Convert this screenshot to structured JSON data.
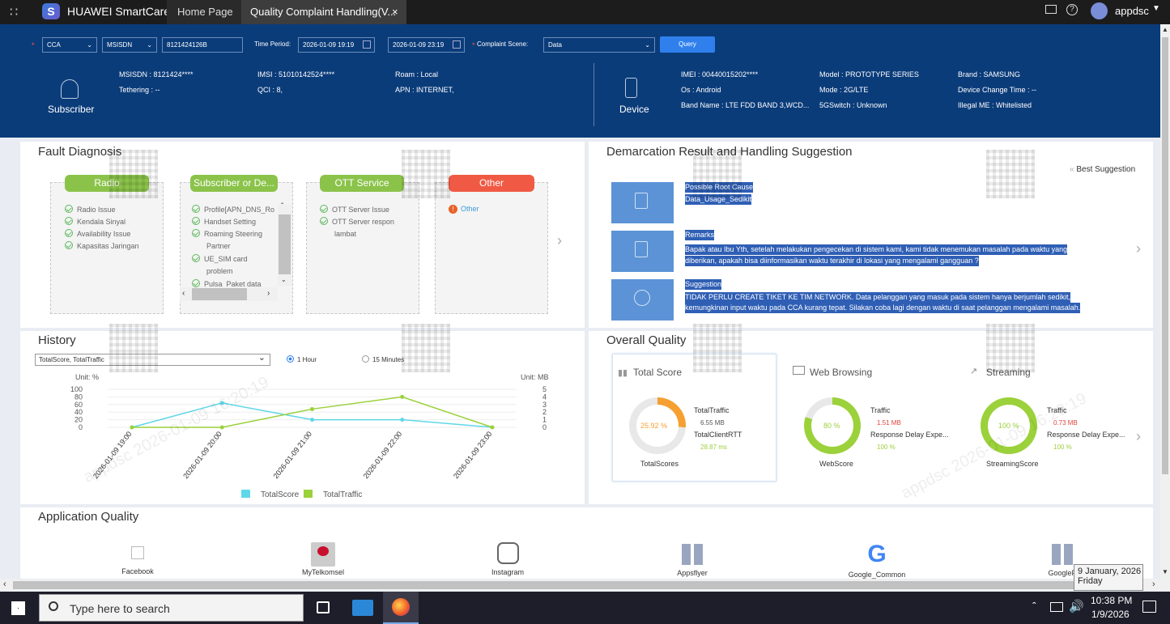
{
  "app": {
    "title": "HUAWEI SmartCare",
    "user": "appdsc"
  },
  "tabs": [
    {
      "label": "Home Page"
    },
    {
      "label": "Quality Complaint Handling(V..."
    }
  ],
  "query": {
    "cca": "CCA",
    "msisdn_type": "MSISDN",
    "msisdn_value": "8121424126B",
    "time_period_label": "Time Period:",
    "time_start": "2026-01-09 19:19",
    "time_end": "2026-01-09 23:19",
    "complaint_scene_label": "Complaint Scene:",
    "complaint_scene": "Data",
    "query_button": "Query"
  },
  "subscriber": {
    "label": "Subscriber",
    "msisdn": "MSISDN : 8121424****",
    "tethering": "Tethering : --",
    "imsi": "IMSI : 51010142524****",
    "qci": "QCI : 8,",
    "roam": "Roam : Local",
    "apn": "APN : INTERNET,"
  },
  "device": {
    "label": "Device",
    "imei": "IMEI : 00440015202****",
    "os": "Os : Android",
    "band": "Band Name : LTE FDD BAND 3,WCD...",
    "model": "Model : PROTOTYPE SERIES",
    "mode": "Mode : 2G/LTE",
    "switch5g": "5GSwitch : Unknown",
    "brand": "Brand : SAMSUNG",
    "change_time": "Device Change Time : --",
    "illegal": "Illegal ME : Whitelisted"
  },
  "fault": {
    "title": "Fault Diagnosis",
    "radio": {
      "label": "Radio",
      "items": [
        "Radio Issue",
        "Kendala Sinyal",
        "Availability Issue",
        "Kapasitas Jaringan"
      ]
    },
    "subscriber": {
      "label": "Subscriber or De...",
      "items": [
        "Profile[APN_DNS_Ro",
        "Handset Setting",
        "Roaming Steering",
        "Partner",
        "UE_SIM card",
        "problem",
        "Pulsa_Paket data"
      ]
    },
    "ott": {
      "label": "OTT Service",
      "items": [
        "OTT Server Issue",
        "OTT Server respon",
        "lambat"
      ]
    },
    "other": {
      "label": "Other",
      "items": [
        "Other"
      ]
    }
  },
  "demarcation": {
    "title": "Demarcation Result and Handling Suggestion",
    "best": "Best Suggestion",
    "cause_label": "Possible Root Cause",
    "cause_value": "Data_Usage_Sedikit",
    "remarks_label": "Remarks",
    "remarks_1": "Bapak atau Ibu Yth, setelah melakukan pengecekan di sistem kami, kami tidak menemukan masalah pada waktu yang",
    "remarks_2": "diberikan, apakah bisa diinformasikan waktu terakhir di lokasi yang mengalami gangguan ?",
    "suggestion_label": "Suggestion",
    "suggestion_1": "TIDAK PERLU CREATE TIKET KE TIM NETWORK. Data pelanggan yang masuk pada sistem hanya berjumlah sedikit,",
    "suggestion_2": "kemungkinan input waktu pada CCA kurang tepat. Silakan coba lagi dengan waktu di saat pelanggan mengalami masalah."
  },
  "history": {
    "title": "History",
    "select": "TotalScore, TotalTraffic",
    "radio_1h": "1 Hour",
    "radio_15m": "15 Minutes",
    "unit_left": "Unit: %",
    "unit_right": "Unit: MB"
  },
  "chart_data": {
    "type": "line",
    "categories": [
      "2026-01-09 19:00",
      "2026-01-09 20:00",
      "2026-01-09 21:00",
      "2026-01-09 22:00",
      "2026-01-09 23:00"
    ],
    "series": [
      {
        "name": "TotalScore",
        "axis": "left",
        "color": "#5fd7e8",
        "values": [
          0,
          64,
          20,
          20,
          0
        ]
      },
      {
        "name": "TotalTraffic",
        "axis": "right",
        "color": "#9bd13a",
        "values": [
          0,
          0,
          2.4,
          4,
          0
        ]
      }
    ],
    "ylim_left": [
      0,
      100
    ],
    "yticks_left": [
      "100",
      "80",
      "60",
      "40",
      "20",
      "0"
    ],
    "ylim_right": [
      0,
      5
    ],
    "yticks_right": [
      "5",
      "4",
      "3",
      "2",
      "1",
      "0"
    ],
    "legend": "bottom"
  },
  "overall": {
    "title": "Overall Quality",
    "total": {
      "label": "Total Score",
      "value": "25.92 %",
      "pct": 25.92,
      "k1": "TotalTraffic",
      "v1": "6.55 MB",
      "k2": "TotalClientRTT",
      "v2": "28.87 ms",
      "foot": "TotalScores"
    },
    "web": {
      "label": "Web Browsing",
      "value": "80 %",
      "pct": 80,
      "k1": "Traffic",
      "v1": "1.51 MB",
      "k2": "Response Delay Expe...",
      "v2": "100 %",
      "foot": "WebScore"
    },
    "stream": {
      "label": "Streaming",
      "value": "100 %",
      "pct": 100,
      "k1": "Traffic",
      "v1": "0.73 MB",
      "k2": "Response Delay Expe...",
      "v2": "100 %",
      "foot": "StreamingScore"
    }
  },
  "apps": {
    "title": "Application Quality",
    "items": [
      "Facebook",
      "MyTelkomsel",
      "Instagram",
      "Appsflyer",
      "Google_Common",
      "GoogleP"
    ]
  },
  "watermark": "appdsc 2026-01-09 16:20:19",
  "taskbar": {
    "search": "Type here to search",
    "time": "10:38 PM",
    "date": "1/9/2026",
    "tooltip_date": "9 January, 2026",
    "tooltip_day": "Friday"
  },
  "colors": {
    "radio": "#8bc34a",
    "other": "#f05a44",
    "accent": "#0b3c7a",
    "orange": "#f5a031",
    "green": "#9bd13a"
  }
}
